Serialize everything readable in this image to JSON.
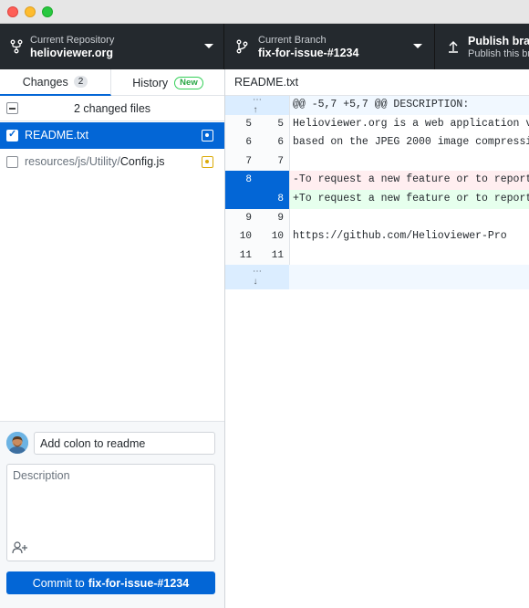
{
  "toolbar": {
    "repo_sub": "Current Repository",
    "repo_name": "helioviewer.org",
    "branch_sub": "Current Branch",
    "branch_name": "fix-for-issue-#1234",
    "publish_title": "Publish branch",
    "publish_sub": "Publish this branch"
  },
  "tabs": {
    "changes_label": "Changes",
    "changes_count": "2",
    "history_label": "History",
    "history_badge": "New"
  },
  "files": {
    "header": "2 changed files",
    "items": [
      {
        "dir": "",
        "name": "README.txt",
        "checked": true,
        "status": "modified"
      },
      {
        "dir": "resources/js/Utility/",
        "name": "Config.js",
        "checked": false,
        "status": "modified"
      }
    ]
  },
  "commit": {
    "summary_value": "Add colon to readme",
    "description_placeholder": "Description",
    "button_prefix": "Commit to",
    "button_branch": "fix-for-issue-#1234"
  },
  "diff": {
    "filename": "README.txt",
    "hunk_header": "@@ -5,7 +5,7 @@ DESCRIPTION:",
    "lines": [
      {
        "type": "ctx",
        "old": "5",
        "new": "5",
        "text": " Helioviewer.org is a web application v"
      },
      {
        "type": "ctx",
        "old": "6",
        "new": "6",
        "text": " based on the JPEG 2000 image compressi"
      },
      {
        "type": "ctx",
        "old": "7",
        "new": "7",
        "text": ""
      },
      {
        "type": "del",
        "old": "8",
        "new": "",
        "text": "-To request a new feature or to report"
      },
      {
        "type": "add",
        "old": "",
        "new": "8",
        "text": "+To request a new feature or to report"
      },
      {
        "type": "ctx",
        "old": "9",
        "new": "9",
        "text": ""
      },
      {
        "type": "ctx",
        "old": "10",
        "new": "10",
        "text": "     https://github.com/Helioviewer-Pro"
      },
      {
        "type": "ctx",
        "old": "11",
        "new": "11",
        "text": ""
      }
    ]
  },
  "colors": {
    "accent": "#0366d6",
    "toolbar_bg": "#24292e",
    "deleted_bg": "#ffeef0",
    "added_bg": "#e6ffed"
  }
}
